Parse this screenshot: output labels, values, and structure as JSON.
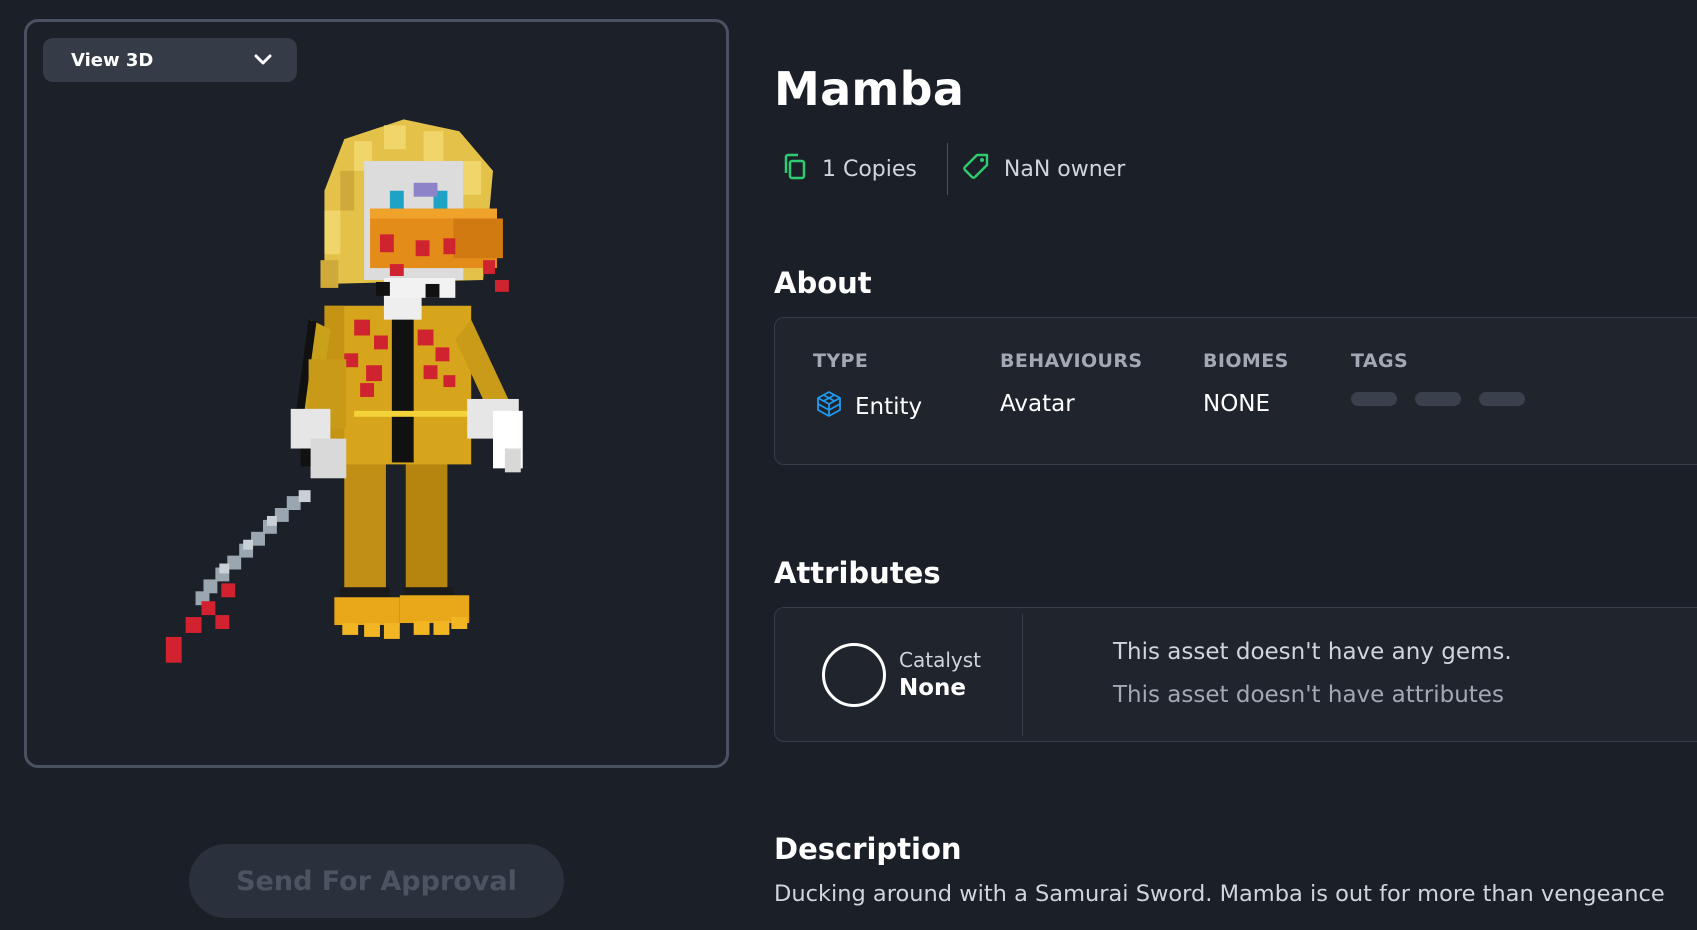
{
  "preview": {
    "view_mode": "View 3D",
    "view_mode_icon": "chevron-down-icon"
  },
  "actions": {
    "send_for_approval": "Send For Approval"
  },
  "asset": {
    "title": "Mamba",
    "copies": "1 Copies",
    "owner": "NaN owner",
    "copies_icon": "copy-icon",
    "owner_icon": "tag-icon"
  },
  "about": {
    "heading": "About",
    "type_label": "TYPE",
    "type_value": "Entity",
    "type_icon": "entity-cube-icon",
    "behaviours_label": "BEHAVIOURS",
    "behaviours_value": "Avatar",
    "biomes_label": "BIOMES",
    "biomes_value": "NONE",
    "tags_label": "TAGS"
  },
  "attributes": {
    "heading": "Attributes",
    "catalyst_label": "Catalyst",
    "catalyst_value": "None",
    "gems_message": "This asset doesn't have any gems.",
    "attributes_message": "This asset doesn't have attributes"
  },
  "description": {
    "heading": "Description",
    "text": "Ducking around with a Samurai Sword. Mamba is out for more than vengeance"
  },
  "colors": {
    "background": "#1b1f27",
    "accent_green": "#2ecc71",
    "accent_blue": "#1e9bf0"
  }
}
